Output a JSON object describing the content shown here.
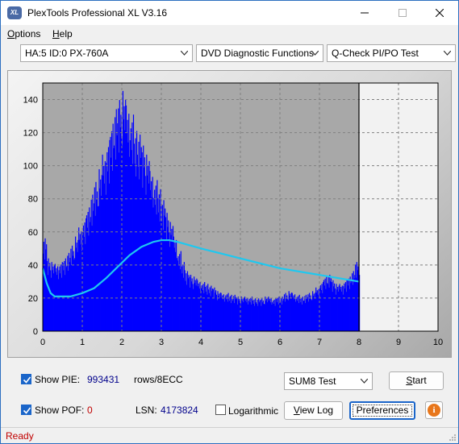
{
  "window": {
    "title": "PlexTools Professional XL V3.16",
    "icon_text": "XL"
  },
  "menu": {
    "items": [
      {
        "label": "Options",
        "accel": "O"
      },
      {
        "label": "Help",
        "accel": "H"
      }
    ]
  },
  "toolbar": {
    "drive": "HA:5 ID:0  PX-760A",
    "function": "DVD Diagnostic Functions",
    "test": "Q-Check PI/PO Test"
  },
  "chart_data": {
    "type": "area",
    "title": "",
    "xlabel": "",
    "ylabel": "",
    "xlim": [
      0,
      10
    ],
    "ylim": [
      0,
      150
    ],
    "x_ticks": [
      "0",
      "1",
      "2",
      "3",
      "4",
      "5",
      "6",
      "7",
      "8",
      "9",
      "10"
    ],
    "y_ticks": [
      "0",
      "20",
      "40",
      "60",
      "80",
      "100",
      "120",
      "140"
    ],
    "grid": true,
    "end_marker_x": 8,
    "colors": {
      "bars": "#0000ff",
      "curve": "#1ec8f0",
      "plot_bg": "#a8a8a8",
      "grid": "#808080"
    },
    "series": [
      {
        "kind": "bars",
        "x": [
          0.0,
          0.1,
          0.2,
          0.3,
          0.4,
          0.5,
          0.6,
          0.7,
          0.8,
          0.9,
          1.0,
          1.1,
          1.2,
          1.3,
          1.4,
          1.5,
          1.6,
          1.7,
          1.8,
          1.9,
          2.0,
          2.1,
          2.2,
          2.3,
          2.4,
          2.5,
          2.6,
          2.7,
          2.8,
          2.9,
          3.0,
          3.1,
          3.2,
          3.3,
          3.4,
          3.5,
          3.6,
          3.7,
          3.8,
          3.9,
          4.0,
          4.1,
          4.2,
          4.3,
          4.4,
          4.5,
          4.6,
          4.7,
          4.8,
          4.9,
          5.0,
          5.1,
          5.2,
          5.3,
          5.4,
          5.5,
          5.6,
          5.7,
          5.8,
          5.9,
          6.0,
          6.1,
          6.2,
          6.3,
          6.4,
          6.5,
          6.6,
          6.7,
          6.8,
          6.9,
          7.0,
          7.1,
          7.2,
          7.3,
          7.4,
          7.5,
          7.6,
          7.7,
          7.8,
          7.9,
          8.0
        ],
        "values": [
          51,
          40,
          38,
          37,
          38,
          40,
          43,
          47,
          52,
          57,
          62,
          68,
          75,
          82,
          89,
          97,
          105,
          114,
          122,
          127,
          132,
          124,
          119,
          110,
          108,
          102,
          97,
          88,
          83,
          78,
          72,
          65,
          60,
          52,
          44,
          38,
          33,
          31,
          30,
          28,
          27,
          26,
          25,
          24,
          22,
          21,
          21,
          20,
          20,
          19,
          19,
          19,
          19,
          18,
          18,
          18,
          19,
          19,
          18,
          19,
          19,
          21,
          22,
          21,
          20,
          19,
          20,
          21,
          22,
          24,
          27,
          30,
          31,
          28,
          26,
          26,
          28,
          30,
          33,
          38,
          40
        ]
      },
      {
        "kind": "line",
        "x": [
          0,
          0.1,
          0.2,
          0.3,
          0.4,
          0.5,
          0.7,
          1.0,
          1.3,
          1.6,
          1.9,
          2.2,
          2.5,
          2.8,
          3.0,
          3.2,
          3.4,
          3.7,
          4.0,
          4.5,
          5.0,
          5.5,
          6.0,
          6.5,
          7.0,
          7.5,
          8.0
        ],
        "values": [
          38,
          29,
          23,
          21,
          21,
          21,
          21,
          23,
          26,
          32,
          39,
          46,
          51,
          54,
          55,
          55,
          54,
          52,
          50,
          47,
          44,
          41,
          38,
          36,
          34,
          32,
          30
        ]
      }
    ]
  },
  "controls": {
    "show_pie_label": "Show PIE:",
    "show_pie_checked": true,
    "pie_value": "993431",
    "pie_unit": "rows/8ECC",
    "show_pof_label": "Show POF:",
    "show_pof_checked": true,
    "pof_value": "0",
    "lsn_label": "LSN:",
    "lsn_value": "4173824",
    "logarithmic_label": "Logarithmic",
    "logarithmic_checked": false,
    "test_mode": "SUM8 Test",
    "start_label": "Start",
    "view_log_label": "View Log",
    "preferences_label": "Preferences",
    "info_icon_text": "i"
  },
  "status": {
    "text": "Ready"
  }
}
